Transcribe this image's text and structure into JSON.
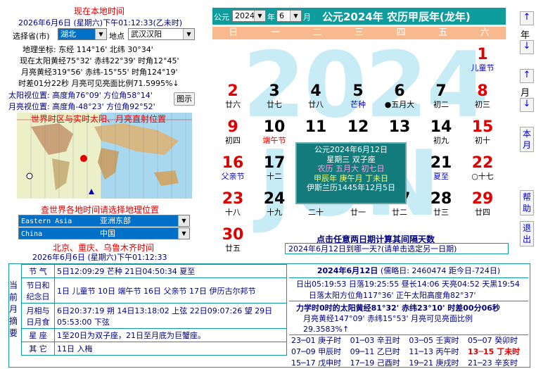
{
  "left": {
    "title_local": "现在本地时间",
    "local_datetime": "2026年6月6日 (星期六)下午01:12:33(乙未时)",
    "province_label": "选择省(市)",
    "province_value": "湖北",
    "place_label": "地点",
    "place_value": "武汉汉阳",
    "geo_line": "地理坐标:  东经 114°16'  北纬 30°34'",
    "sun_line1": "现在太阳黄经75°32'  赤纬22°39' 时角12°45'",
    "moon_line1": "月亮黄经319°56'  赤纬-15°55' 时角124°19'",
    "diff_line": "时差01分22秒  月亮可见亮面比例71.5995%↓",
    "sun_pos": "太阳视位置: 高度角76°09' 方位角58°14'",
    "moon_pos": "月亮视位置: 高度角-48°23' 方位角92°52'",
    "chart_button": "图示",
    "map_caption": "世界时区与实时太阳、月亮直射位置",
    "world_time_link": "查世界各地时间请选择地理位置",
    "region_en": "Eastern Asia",
    "region_cn": "亚洲东部",
    "country_en": "China",
    "country_cn": "中国",
    "beijing_label": "北京、重庆、乌鲁木齐时间",
    "beijing_time": "2026年6月6日 (星期六)下午01:12:33"
  },
  "header": {
    "gongyuan": "公元",
    "year_value": "2024",
    "year_unit": "年",
    "month_value": "6",
    "month_unit": "月",
    "title": "公元2024年  农历甲辰年(龙年)"
  },
  "weekdays": [
    "日",
    "一",
    "二",
    "三",
    "四",
    "五",
    "六"
  ],
  "watermark": {
    "year": "2024",
    "month": "JUN"
  },
  "days": [
    {
      "n": "1",
      "s": "儿童节",
      "col": 6,
      "row": 0,
      "nc": "red",
      "sc": "blue"
    },
    {
      "n": "2",
      "s": "廿六",
      "col": 0,
      "row": 1,
      "nc": "red",
      "sc": "black"
    },
    {
      "n": "3",
      "s": "廿七",
      "col": 1,
      "row": 1,
      "nc": "black",
      "sc": "black"
    },
    {
      "n": "4",
      "s": "廿八",
      "col": 2,
      "row": 1,
      "nc": "black",
      "sc": "black"
    },
    {
      "n": "5",
      "s": "芒种",
      "col": 3,
      "row": 1,
      "nc": "black",
      "sc": "blue"
    },
    {
      "n": "6",
      "s": "●五月大",
      "col": 4,
      "row": 1,
      "nc": "black",
      "sc": "black"
    },
    {
      "n": "7",
      "s": "初二",
      "col": 5,
      "row": 1,
      "nc": "black",
      "sc": "black"
    },
    {
      "n": "8",
      "s": "初三",
      "col": 6,
      "row": 1,
      "nc": "red",
      "sc": "black"
    },
    {
      "n": "9",
      "s": "初四",
      "col": 0,
      "row": 2,
      "nc": "red",
      "sc": "black"
    },
    {
      "n": "10",
      "s": "端午节",
      "col": 1,
      "row": 2,
      "nc": "black",
      "sc": "red"
    },
    {
      "n": "11",
      "s": "",
      "col": 2,
      "row": 2,
      "nc": "black",
      "sc": "black"
    },
    {
      "n": "12",
      "s": "",
      "col": 3,
      "row": 2,
      "nc": "black",
      "sc": "black"
    },
    {
      "n": "13",
      "s": "",
      "col": 4,
      "row": 2,
      "nc": "black",
      "sc": "black"
    },
    {
      "n": "14",
      "s": "初九",
      "col": 5,
      "row": 2,
      "nc": "black",
      "sc": "black"
    },
    {
      "n": "15",
      "s": "初十",
      "col": 6,
      "row": 2,
      "nc": "red",
      "sc": "black"
    },
    {
      "n": "16",
      "s": "父亲节",
      "col": 0,
      "row": 3,
      "nc": "red",
      "sc": "blue"
    },
    {
      "n": "17",
      "s": "十二",
      "col": 1,
      "row": 3,
      "nc": "black",
      "sc": "black"
    },
    {
      "n": "21",
      "s": "夏至",
      "col": 5,
      "row": 3,
      "nc": "black",
      "sc": "blue"
    },
    {
      "n": "22",
      "s": "○十七",
      "col": 6,
      "row": 3,
      "nc": "red",
      "sc": "black"
    },
    {
      "n": "23",
      "s": "十八",
      "col": 0,
      "row": 4,
      "nc": "red",
      "sc": "black"
    },
    {
      "n": "24",
      "s": "十九",
      "col": 1,
      "row": 4,
      "nc": "black",
      "sc": "black"
    },
    {
      "n": "25",
      "s": "二十",
      "col": 2,
      "row": 4,
      "nc": "black",
      "sc": "black"
    },
    {
      "n": "26",
      "s": "廿一",
      "col": 3,
      "row": 4,
      "nc": "black",
      "sc": "black"
    },
    {
      "n": "27",
      "s": "廿二",
      "col": 4,
      "row": 4,
      "nc": "black",
      "sc": "black"
    },
    {
      "n": "28",
      "s": "廿三",
      "col": 5,
      "row": 4,
      "nc": "black",
      "sc": "black"
    },
    {
      "n": "29",
      "s": "廿四",
      "col": 6,
      "row": 4,
      "nc": "red",
      "sc": "black"
    },
    {
      "n": "30",
      "s": "廿五",
      "col": 0,
      "row": 5,
      "nc": "red",
      "sc": "black"
    }
  ],
  "popup": {
    "l1": "公元2024年6月12日",
    "l2": "星期三  双子座",
    "l3": "农历  五月大  初七日",
    "l4": "甲辰年  庚午月  丁未日",
    "l5": "伊斯兰历1445年12月5日"
  },
  "interval": {
    "title": "点击任意两日期计算其间隔天数",
    "text": "2024年6月12日到哪一天?(请单击选定另一日期)"
  },
  "rightnav": {
    "year": "年",
    "month": "月",
    "this_month": "本月",
    "help": "帮助",
    "exit": "退出",
    "up": "↑",
    "down": "↓"
  },
  "summary": {
    "side_label": "当前月摘要",
    "rows": [
      {
        "label": "节  气",
        "value": "5日12:09:29 芒种   21日04:50:34 夏至"
      },
      {
        "label": "节日和纪念日",
        "value": "1日 儿童节  10日 端午节  16日 父亲节   17日 伊历古尔邦节"
      },
      {
        "label": "月相与日月食",
        "value": "6日20:37:19 朔  14日13:18:02 上弦  22日09:07:26 望  29日05:53:00 下弦"
      },
      {
        "label": "星  座",
        "value": "1至20日为双子座，21日至月底为巨蟹座。"
      },
      {
        "label": "其  它",
        "value": "11日 入梅"
      }
    ]
  },
  "dayinfo": {
    "date": "2024年6月12日",
    "julian": "(儒略日: 2460474   距今日-724日)",
    "sun1": "日出05:19:53 日落19:25:55  昼长14:06  天亮04:52 天黑19:54",
    "sun2": "日落太阳方位角117°36'  正午太阳高度角82°37'",
    "calc1": "力学时0时的太阳黄经81°32'  赤纬23°10' 时差00分06秒",
    "calc2": "月亮黄经147°09'  赤纬15°53'  月亮可见亮面比例29.3583%↑",
    "hours": [
      [
        "23─01 庚子时",
        "01─03 辛丑时",
        "03─05 壬寅时",
        "05─07 癸卯时"
      ],
      [
        "07─09 甲辰时",
        "09─11 乙巳时",
        "11─13 丙午时",
        "13─15 丁未时"
      ],
      [
        "15─17 戊申时",
        "17─19 己酉时",
        "19─21 庚戌时",
        "21─23 辛亥时"
      ]
    ]
  }
}
